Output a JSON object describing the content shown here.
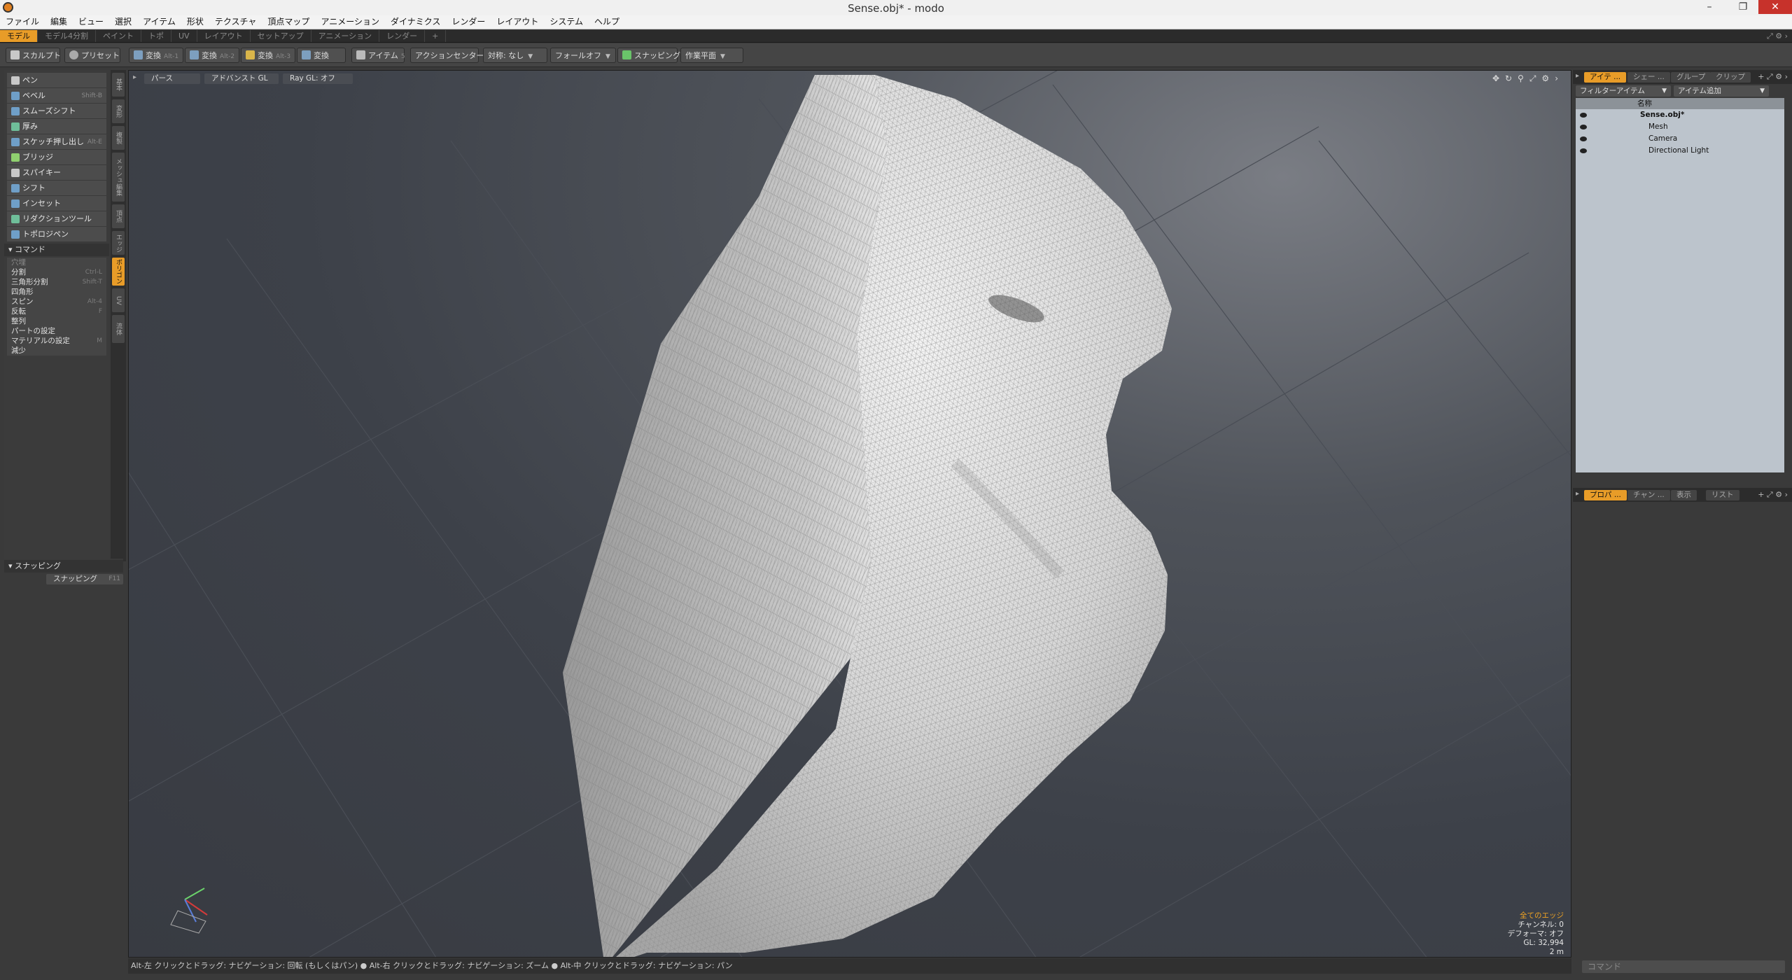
{
  "window": {
    "title": "Sense.obj* - modo"
  },
  "menu": [
    "ファイル",
    "編集",
    "ビュー",
    "選択",
    "アイテム",
    "形状",
    "テクスチャ",
    "頂点マップ",
    "アニメーション",
    "ダイナミクス",
    "レンダー",
    "レイアウト",
    "システム",
    "ヘルプ"
  ],
  "layout_tabs": [
    {
      "label": "モデル",
      "active": true
    },
    {
      "label": "モデル4分割"
    },
    {
      "label": "ペイント"
    },
    {
      "label": "トポ"
    },
    {
      "label": "UV"
    },
    {
      "label": "レイアウト"
    },
    {
      "label": "セットアップ"
    },
    {
      "label": "アニメーション"
    },
    {
      "label": "レンダー"
    },
    {
      "label": "+"
    }
  ],
  "toolbar": {
    "sculpt": "スカルプト",
    "preset": "プリセット",
    "xforms": [
      {
        "label": "変換",
        "sc": "Alt-1"
      },
      {
        "label": "変換",
        "sc": "Alt-2"
      },
      {
        "label": "変換",
        "sc": "Alt-3"
      },
      {
        "label": "変換",
        "sc": ""
      }
    ],
    "item": "アイテム",
    "item_sc": "5",
    "action_center": "アクションセンター",
    "symmetry": "対称: なし",
    "falloff": "フォールオフ",
    "snapping": "スナッピング",
    "work_plane": "作業平面"
  },
  "tools": [
    {
      "label": "ペン",
      "sc": ""
    },
    {
      "label": "ベベル",
      "sc": "Shift-B"
    },
    {
      "label": "スムーズシフト",
      "sc": ""
    },
    {
      "label": "厚み",
      "sc": ""
    },
    {
      "label": "スケッチ押し出し",
      "sc": "Alt-E"
    },
    {
      "label": "ブリッジ",
      "sc": ""
    },
    {
      "label": "スパイキー",
      "sc": ""
    },
    {
      "label": "シフト",
      "sc": ""
    },
    {
      "label": "インセット",
      "sc": ""
    },
    {
      "label": "リダクションツール",
      "sc": ""
    },
    {
      "label": "トポロジペン",
      "sc": ""
    }
  ],
  "commands_header": "コマンド",
  "commands": [
    {
      "label": "分割",
      "sc": "Ctrl-L"
    },
    {
      "label": "三角形分割",
      "sc": "Shift-T"
    },
    {
      "label": "四角形",
      "sc": ""
    },
    {
      "label": "スピン",
      "sc": "Alt-4"
    },
    {
      "label": "反転",
      "sc": "F"
    },
    {
      "label": "整列",
      "sc": ""
    },
    {
      "label": "パートの設定",
      "sc": ""
    },
    {
      "label": "マテリアルの設定",
      "sc": "M"
    },
    {
      "label": "減少",
      "sc": ""
    }
  ],
  "commands_dim": "穴埋",
  "vtabs": [
    "基本",
    "変形",
    "複製",
    "メッシュ編集",
    "頂点",
    "エッジ",
    "ポリゴン",
    "UV",
    "流体"
  ],
  "snap": {
    "header": "スナッピング",
    "button": "スナッピング",
    "sc": "F11"
  },
  "viewport": {
    "chips": [
      "パース",
      "アドバンスト GL",
      "Ray GL: オフ"
    ],
    "info": {
      "line1": "全てのエッジ",
      "line2": "チャンネル: 0",
      "line3": "デフォーマ: オフ",
      "line4": "GL: 32,994",
      "line5": "2 m"
    }
  },
  "status": "Alt-左 クリックとドラッグ: ナビゲーション: 回転 (もしくはパン) ● Alt-右 クリックとドラッグ: ナビゲーション: ズーム ● Alt-中 クリックとドラッグ: ナビゲーション: パン",
  "rpanel": {
    "tabs_top": [
      "アイテ ...",
      "シェー ...",
      "グループ",
      "クリップ"
    ],
    "filter": "フィルターアイテム",
    "add_item": "アイテム追加",
    "col_name": "名称",
    "items": [
      {
        "label": "Sense.obj*",
        "indent": 1
      },
      {
        "label": "Mesh",
        "indent": 2
      },
      {
        "label": "Camera",
        "indent": 2
      },
      {
        "label": "Directional Light",
        "indent": 2
      }
    ],
    "tabs_bottom": [
      "プロパ ...",
      "チャン ...",
      "表示",
      "リスト"
    ]
  },
  "command_placeholder": "コマンド",
  "colors": {
    "accent": "#e89c28",
    "viewport_bg": "#3d4149"
  }
}
